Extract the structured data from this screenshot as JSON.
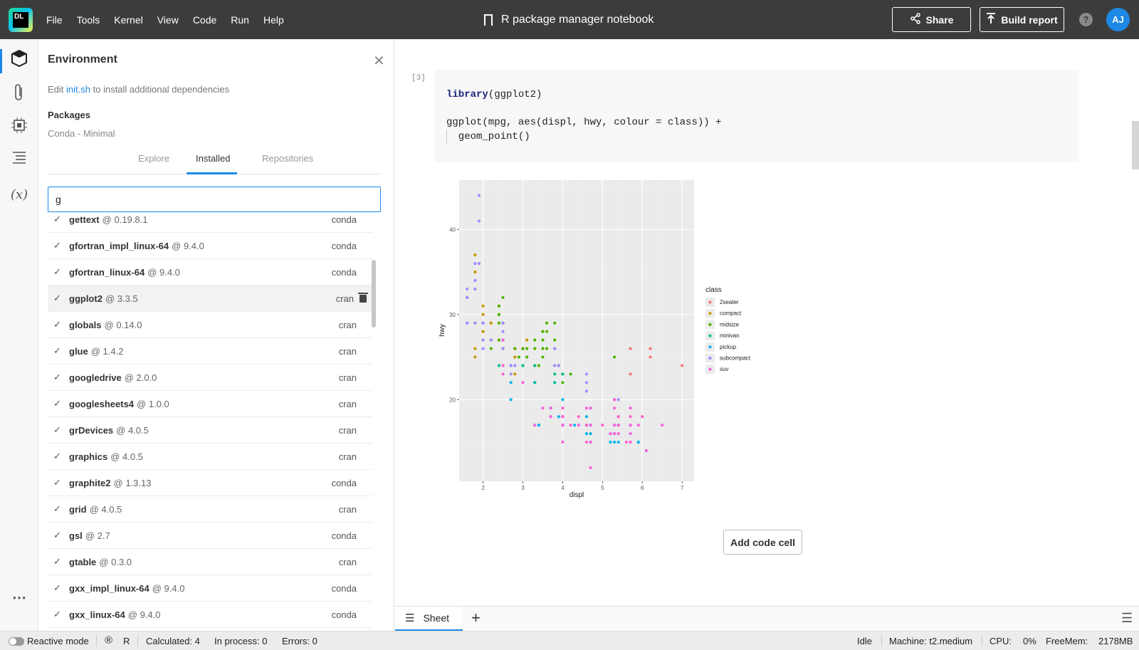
{
  "app": {
    "logo_text": "DL",
    "menu": [
      "File",
      "Tools",
      "Kernel",
      "View",
      "Code",
      "Run",
      "Help"
    ],
    "title": "R package manager notebook",
    "share_label": "Share",
    "build_label": "Build report",
    "help_glyph": "?",
    "avatar_initials": "AJ"
  },
  "environment": {
    "title": "Environment",
    "hint_prefix": "Edit",
    "hint_link": "init.sh",
    "hint_suffix": "to install additional dependencies",
    "packages_title": "Packages",
    "packages_subtitle": "Conda - Minimal",
    "tabs": [
      "Explore",
      "Installed",
      "Repositories"
    ],
    "active_tab": "Installed",
    "search_value": "g",
    "packages": [
      {
        "name": "gettext",
        "version": "0.19.8.1",
        "source": "conda"
      },
      {
        "name": "gfortran_impl_linux-64",
        "version": "9.4.0",
        "source": "conda"
      },
      {
        "name": "gfortran_linux-64",
        "version": "9.4.0",
        "source": "conda"
      },
      {
        "name": "ggplot2",
        "version": "3.3.5",
        "source": "cran"
      },
      {
        "name": "globals",
        "version": "0.14.0",
        "source": "cran"
      },
      {
        "name": "glue",
        "version": "1.4.2",
        "source": "cran"
      },
      {
        "name": "googledrive",
        "version": "2.0.0",
        "source": "cran"
      },
      {
        "name": "googlesheets4",
        "version": "1.0.0",
        "source": "cran"
      },
      {
        "name": "grDevices",
        "version": "4.0.5",
        "source": "cran"
      },
      {
        "name": "graphics",
        "version": "4.0.5",
        "source": "cran"
      },
      {
        "name": "graphite2",
        "version": "1.3.13",
        "source": "conda"
      },
      {
        "name": "grid",
        "version": "4.0.5",
        "source": "cran"
      },
      {
        "name": "gsl",
        "version": "2.7",
        "source": "conda"
      },
      {
        "name": "gtable",
        "version": "0.3.0",
        "source": "cran"
      },
      {
        "name": "gxx_impl_linux-64",
        "version": "9.4.0",
        "source": "conda"
      },
      {
        "name": "gxx_linux-64",
        "version": "9.4.0",
        "source": "conda"
      }
    ]
  },
  "notebook": {
    "cell_number": "[3]",
    "code_lines": [
      {
        "kw": "library",
        "rest": "(ggplot2)"
      },
      {
        "kw": "",
        "rest": ""
      },
      {
        "kw": "",
        "rest": "ggplot(mpg, aes(displ, hwy, colour = class)) +"
      },
      {
        "kw": "",
        "rest": "  geom_point()"
      }
    ],
    "add_cell_label": "Add code cell"
  },
  "sheets": {
    "tab_label": "Sheet",
    "add_glyph": "+"
  },
  "status": {
    "reactive_mode": "Reactive mode",
    "language": "R",
    "calculated": "Calculated: 4",
    "in_process": "In process: 0",
    "errors": "Errors: 0",
    "state": "Idle",
    "machine": "Machine: t2.medium",
    "cpu_label": "CPU:",
    "cpu_value": "0%",
    "freemem_label": "FreeMem:",
    "freemem_value": "2178MB"
  },
  "colors": {
    "accent": "#1e88e5",
    "topbar": "#3c3c3c",
    "plot_bg": "#ebebeb"
  },
  "chart_data": {
    "type": "scatter",
    "xlabel": "displ",
    "ylabel": "hwy",
    "xlim": [
      1.4,
      7.3
    ],
    "ylim": [
      10.4,
      45.8
    ],
    "x_ticks": [
      2,
      3,
      4,
      5,
      6,
      7
    ],
    "y_ticks": [
      20,
      30,
      40
    ],
    "grid": true,
    "legend_title": "class",
    "legend_position": "right",
    "series": [
      {
        "name": "2seater",
        "color": "#f8766d",
        "points": [
          [
            5.7,
            26
          ],
          [
            5.7,
            23
          ],
          [
            6.2,
            26
          ],
          [
            6.2,
            25
          ],
          [
            7.0,
            24
          ]
        ]
      },
      {
        "name": "compact",
        "color": "#c49a00",
        "points": [
          [
            1.8,
            29
          ],
          [
            1.8,
            29
          ],
          [
            2.0,
            31
          ],
          [
            2.0,
            30
          ],
          [
            2.8,
            26
          ],
          [
            2.8,
            26
          ],
          [
            3.1,
            27
          ],
          [
            1.8,
            26
          ],
          [
            1.8,
            25
          ],
          [
            2.0,
            28
          ],
          [
            2.0,
            27
          ],
          [
            2.8,
            25
          ],
          [
            2.8,
            25
          ],
          [
            3.1,
            25
          ],
          [
            2.2,
            27
          ],
          [
            2.2,
            29
          ],
          [
            2.4,
            31
          ],
          [
            2.4,
            31
          ],
          [
            3.0,
            26
          ],
          [
            3.3,
            26
          ],
          [
            1.8,
            35
          ],
          [
            1.8,
            37
          ],
          [
            1.8,
            35
          ],
          [
            1.8,
            33
          ],
          [
            2.0,
            28
          ],
          [
            2.2,
            29
          ],
          [
            2.5,
            27
          ],
          [
            2.5,
            29
          ],
          [
            2.8,
            23
          ],
          [
            2.5,
            26
          ],
          [
            2.0,
            29
          ],
          [
            2.0,
            28
          ],
          [
            2.4,
            27
          ]
        ]
      },
      {
        "name": "midsize",
        "color": "#53b400",
        "points": [
          [
            2.4,
            27
          ],
          [
            2.4,
            30
          ],
          [
            2.5,
            32
          ],
          [
            3.0,
            26
          ],
          [
            3.1,
            25
          ],
          [
            3.3,
            26
          ],
          [
            3.5,
            27
          ],
          [
            3.5,
            28
          ],
          [
            3.8,
            26
          ],
          [
            3.8,
            26
          ],
          [
            3.8,
            27
          ],
          [
            3.4,
            24
          ],
          [
            3.6,
            26
          ],
          [
            3.6,
            29
          ],
          [
            3.6,
            28
          ],
          [
            3.9,
            24
          ],
          [
            4.0,
            23
          ],
          [
            4.0,
            22
          ],
          [
            2.4,
            30
          ],
          [
            2.5,
            29
          ],
          [
            2.8,
            26
          ],
          [
            3.1,
            26
          ],
          [
            2.7,
            24
          ],
          [
            2.9,
            25
          ],
          [
            3.3,
            27
          ],
          [
            3.8,
            29
          ],
          [
            3.5,
            26
          ],
          [
            3.5,
            28
          ],
          [
            3.9,
            24
          ],
          [
            2.2,
            26
          ],
          [
            2.5,
            26
          ],
          [
            3.0,
            26
          ],
          [
            5.3,
            25
          ],
          [
            2.2,
            27
          ],
          [
            2.4,
            29
          ],
          [
            2.8,
            24
          ],
          [
            3.0,
            24
          ],
          [
            2.4,
            31
          ],
          [
            3.3,
            24
          ],
          [
            4.2,
            23
          ],
          [
            3.5,
            25
          ]
        ]
      },
      {
        "name": "minivan",
        "color": "#00c094",
        "points": [
          [
            2.4,
            24
          ],
          [
            3.0,
            24
          ],
          [
            3.3,
            22
          ],
          [
            3.3,
            22
          ],
          [
            3.3,
            24
          ],
          [
            3.8,
            24
          ],
          [
            3.8,
            23
          ],
          [
            4.0,
            23
          ],
          [
            3.8,
            22
          ],
          [
            3.3,
            22
          ],
          [
            3.8,
            22
          ]
        ]
      },
      {
        "name": "pickup",
        "color": "#00b6eb",
        "points": [
          [
            2.7,
            20
          ],
          [
            2.7,
            22
          ],
          [
            3.4,
            17
          ],
          [
            3.4,
            17
          ],
          [
            3.7,
            19
          ],
          [
            3.9,
            18
          ],
          [
            4.0,
            20
          ],
          [
            4.3,
            17
          ],
          [
            4.6,
            17
          ],
          [
            4.6,
            16
          ],
          [
            4.7,
            16
          ],
          [
            4.7,
            15
          ],
          [
            4.7,
            17
          ],
          [
            5.2,
            15
          ],
          [
            5.2,
            16
          ],
          [
            5.4,
            15
          ],
          [
            5.4,
            17
          ],
          [
            5.7,
            17
          ],
          [
            5.9,
            15
          ],
          [
            4.0,
            18
          ],
          [
            4.0,
            17
          ],
          [
            4.6,
            17
          ],
          [
            4.7,
            19
          ],
          [
            5.3,
            15
          ],
          [
            5.3,
            16
          ],
          [
            5.4,
            17
          ],
          [
            5.2,
            16
          ],
          [
            3.7,
            18
          ],
          [
            5.9,
            15
          ],
          [
            2.7,
            24
          ],
          [
            3.7,
            19
          ],
          [
            4.0,
            17
          ],
          [
            4.6,
            18
          ]
        ]
      },
      {
        "name": "subcompact",
        "color": "#a58aff",
        "points": [
          [
            1.6,
            33
          ],
          [
            1.6,
            32
          ],
          [
            1.6,
            29
          ],
          [
            1.8,
            34
          ],
          [
            1.8,
            36
          ],
          [
            1.8,
            33
          ],
          [
            1.9,
            44
          ],
          [
            1.9,
            41
          ],
          [
            2.0,
            29
          ],
          [
            2.0,
            26
          ],
          [
            2.0,
            29
          ],
          [
            2.2,
            27
          ],
          [
            2.5,
            28
          ],
          [
            2.5,
            29
          ],
          [
            3.8,
            26
          ],
          [
            3.8,
            24
          ],
          [
            4.6,
            23
          ],
          [
            4.6,
            22
          ],
          [
            4.6,
            21
          ],
          [
            5.4,
            20
          ],
          [
            2.5,
            27
          ],
          [
            2.5,
            26
          ],
          [
            2.5,
            29
          ],
          [
            2.7,
            24
          ],
          [
            2.7,
            23
          ],
          [
            2.8,
            24
          ],
          [
            3.8,
            26
          ],
          [
            3.9,
            24
          ],
          [
            1.8,
            29
          ],
          [
            2.0,
            29
          ],
          [
            2.0,
            27
          ],
          [
            1.6,
            32
          ],
          [
            1.6,
            29
          ],
          [
            1.9,
            36
          ]
        ]
      },
      {
        "name": "suv",
        "color": "#fb61d7",
        "points": [
          [
            5.7,
            15
          ],
          [
            5.7,
            19
          ],
          [
            5.3,
            17
          ],
          [
            5.3,
            20
          ],
          [
            5.7,
            18
          ],
          [
            6.5,
            17
          ],
          [
            4.7,
            17
          ],
          [
            4.7,
            19
          ],
          [
            4.7,
            15
          ],
          [
            4.7,
            15
          ],
          [
            5.2,
            16
          ],
          [
            5.7,
            17
          ],
          [
            5.9,
            17
          ],
          [
            4.6,
            17
          ],
          [
            5.4,
            18
          ],
          [
            5.4,
            18
          ],
          [
            5.4,
            17
          ],
          [
            5.3,
            20
          ],
          [
            5.3,
            19
          ],
          [
            4.7,
            12
          ],
          [
            5.7,
            15
          ],
          [
            6.1,
            14
          ],
          [
            3.7,
            19
          ],
          [
            4.0,
            19
          ],
          [
            4.0,
            18
          ],
          [
            4.2,
            17
          ],
          [
            4.6,
            17
          ],
          [
            5.0,
            17
          ],
          [
            5.3,
            17
          ],
          [
            5.3,
            16
          ],
          [
            5.3,
            20
          ],
          [
            4.6,
            15
          ],
          [
            5.4,
            16
          ],
          [
            4.0,
            15
          ],
          [
            4.0,
            17
          ],
          [
            4.6,
            19
          ],
          [
            2.5,
            23
          ],
          [
            2.5,
            24
          ],
          [
            3.0,
            22
          ],
          [
            3.5,
            19
          ],
          [
            3.7,
            18
          ],
          [
            4.4,
            18
          ],
          [
            4.4,
            17
          ],
          [
            5.6,
            15
          ],
          [
            5.7,
            16
          ],
          [
            6.0,
            18
          ],
          [
            2.5,
            27
          ],
          [
            3.3,
            17
          ],
          [
            4.0,
            18
          ]
        ]
      }
    ]
  }
}
